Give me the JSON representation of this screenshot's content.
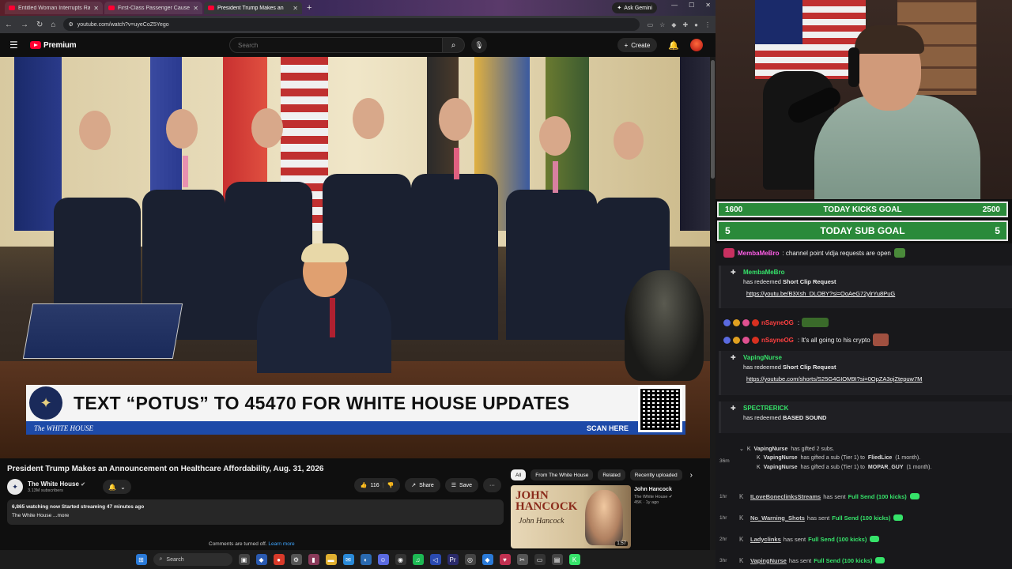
{
  "browser": {
    "tabs": [
      {
        "label": "Entitled Woman Interrupts Rai",
        "active": false
      },
      {
        "label": "First-Class Passenger Causes a",
        "active": false
      },
      {
        "label": "President Trump Makes an",
        "active": true
      }
    ],
    "new_tab": "+",
    "ask_gemini": "Ask Gemini",
    "url": "youtube.com/watch?v=uyeCoZ5Yego"
  },
  "youtube": {
    "brand": "Premium",
    "search_placeholder": "Search",
    "create_label": "Create",
    "video": {
      "banner_text": "TEXT “POTUS” TO 45470 FOR WHITE HOUSE UPDATES",
      "banner_org": "The WHITE HOUSE",
      "banner_scan": "SCAN HERE"
    },
    "title": "President Trump Makes an Announcement on Healthcare Affordability, Aug. 31, 2026",
    "channel": {
      "name": "The White House",
      "subscribers": "3.13M subscribers"
    },
    "actions": {
      "likes": "116",
      "share": "Share",
      "save": "Save",
      "more": "···"
    },
    "description": {
      "stats": "6,865 watching now  Started streaming 47 minutes ago",
      "text": "The White House ...more"
    },
    "comments": {
      "text": "Comments are turned off.",
      "link": "Learn more"
    },
    "chips": [
      "All",
      "From The White House",
      "Related",
      "Recently uploaded"
    ],
    "related": {
      "title": "John Hancock",
      "channel": "The White House",
      "views": "45K · 1y ago",
      "duration": "1:57",
      "thumb_text_1": "JOHN",
      "thumb_text_2": "HANCOCK",
      "thumb_signature": "John Hancock"
    }
  },
  "taskbar": {
    "search": "Search"
  },
  "stream": {
    "kicks_goal": {
      "current": "1600",
      "label": "TODAY KICKS GOAL",
      "target": "2500"
    },
    "sub_goal": {
      "current": "5",
      "label": "TODAY SUB GOAL",
      "target": "5"
    },
    "chat": {
      "pinned": {
        "user": "MembaMeBro",
        "text": ": channel point vidja requests are open"
      },
      "redeems": [
        {
          "user": "MembaMeBro",
          "has": "has redeemed ",
          "reward": "Short Clip Request",
          "link": "https://youtu.be/B3Xsh_DLOBY?si=OoAeG72ylrYu8PuG"
        },
        {
          "user": "VapingNurse",
          "has": "has redeemed ",
          "reward": "Short Clip Request",
          "link": "https://youtube.com/shorts/S25G4GIOM9I?si=0OpZA3ojZtepuw7M"
        },
        {
          "user": "SPECTRERICK",
          "has": "has redeemed ",
          "reward": "BASED SOUND",
          "link": ""
        }
      ],
      "messages": [
        {
          "user": "nSayneOG",
          "text": ":"
        },
        {
          "user": "nSayneOG",
          "text": ": It's all going to his crypto"
        }
      ],
      "gifts": {
        "time": "36m",
        "lines": [
          {
            "user": "VapingNurse",
            "text": "has gifted 2 subs."
          },
          {
            "user": "VapingNurse",
            "text": "has gifted a sub (Tier 1) to",
            "target": "FliedLice",
            "suffix": "(1 month)."
          },
          {
            "user": "VapingNurse",
            "text": "has gifted a sub (Tier 1) to",
            "target": "MOPAR_GUY",
            "suffix": "(1 month)."
          }
        ]
      },
      "events": [
        {
          "time": "1hr",
          "user": "ILoveBoneclinksStreams",
          "mid": "has sent",
          "send": "Full Send (100 kicks)"
        },
        {
          "time": "1hr",
          "user": "No_Warning_Shots",
          "mid": "has sent",
          "send": "Full Send (100 kicks)"
        },
        {
          "time": "2hr",
          "user": "Ladyclinks",
          "mid": "has sent",
          "send": "Full Send (100 kicks)"
        },
        {
          "time": "3hr",
          "user": "VapingNurse",
          "mid": "has sent",
          "send": "Full Send (100 kicks)"
        }
      ]
    }
  }
}
